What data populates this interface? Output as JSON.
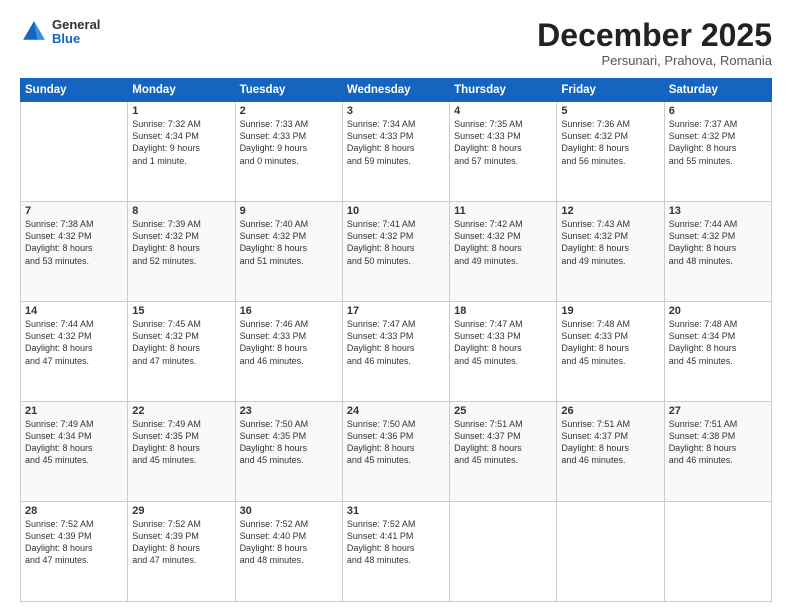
{
  "logo": {
    "general": "General",
    "blue": "Blue"
  },
  "header": {
    "month": "December 2025",
    "location": "Persunari, Prahova, Romania"
  },
  "weekdays": [
    "Sunday",
    "Monday",
    "Tuesday",
    "Wednesday",
    "Thursday",
    "Friday",
    "Saturday"
  ],
  "weeks": [
    [
      {
        "day": "",
        "info": ""
      },
      {
        "day": "1",
        "info": "Sunrise: 7:32 AM\nSunset: 4:34 PM\nDaylight: 9 hours\nand 1 minute."
      },
      {
        "day": "2",
        "info": "Sunrise: 7:33 AM\nSunset: 4:33 PM\nDaylight: 9 hours\nand 0 minutes."
      },
      {
        "day": "3",
        "info": "Sunrise: 7:34 AM\nSunset: 4:33 PM\nDaylight: 8 hours\nand 59 minutes."
      },
      {
        "day": "4",
        "info": "Sunrise: 7:35 AM\nSunset: 4:33 PM\nDaylight: 8 hours\nand 57 minutes."
      },
      {
        "day": "5",
        "info": "Sunrise: 7:36 AM\nSunset: 4:32 PM\nDaylight: 8 hours\nand 56 minutes."
      },
      {
        "day": "6",
        "info": "Sunrise: 7:37 AM\nSunset: 4:32 PM\nDaylight: 8 hours\nand 55 minutes."
      }
    ],
    [
      {
        "day": "7",
        "info": "Sunrise: 7:38 AM\nSunset: 4:32 PM\nDaylight: 8 hours\nand 53 minutes."
      },
      {
        "day": "8",
        "info": "Sunrise: 7:39 AM\nSunset: 4:32 PM\nDaylight: 8 hours\nand 52 minutes."
      },
      {
        "day": "9",
        "info": "Sunrise: 7:40 AM\nSunset: 4:32 PM\nDaylight: 8 hours\nand 51 minutes."
      },
      {
        "day": "10",
        "info": "Sunrise: 7:41 AM\nSunset: 4:32 PM\nDaylight: 8 hours\nand 50 minutes."
      },
      {
        "day": "11",
        "info": "Sunrise: 7:42 AM\nSunset: 4:32 PM\nDaylight: 8 hours\nand 49 minutes."
      },
      {
        "day": "12",
        "info": "Sunrise: 7:43 AM\nSunset: 4:32 PM\nDaylight: 8 hours\nand 49 minutes."
      },
      {
        "day": "13",
        "info": "Sunrise: 7:44 AM\nSunset: 4:32 PM\nDaylight: 8 hours\nand 48 minutes."
      }
    ],
    [
      {
        "day": "14",
        "info": "Sunrise: 7:44 AM\nSunset: 4:32 PM\nDaylight: 8 hours\nand 47 minutes."
      },
      {
        "day": "15",
        "info": "Sunrise: 7:45 AM\nSunset: 4:32 PM\nDaylight: 8 hours\nand 47 minutes."
      },
      {
        "day": "16",
        "info": "Sunrise: 7:46 AM\nSunset: 4:33 PM\nDaylight: 8 hours\nand 46 minutes."
      },
      {
        "day": "17",
        "info": "Sunrise: 7:47 AM\nSunset: 4:33 PM\nDaylight: 8 hours\nand 46 minutes."
      },
      {
        "day": "18",
        "info": "Sunrise: 7:47 AM\nSunset: 4:33 PM\nDaylight: 8 hours\nand 45 minutes."
      },
      {
        "day": "19",
        "info": "Sunrise: 7:48 AM\nSunset: 4:33 PM\nDaylight: 8 hours\nand 45 minutes."
      },
      {
        "day": "20",
        "info": "Sunrise: 7:48 AM\nSunset: 4:34 PM\nDaylight: 8 hours\nand 45 minutes."
      }
    ],
    [
      {
        "day": "21",
        "info": "Sunrise: 7:49 AM\nSunset: 4:34 PM\nDaylight: 8 hours\nand 45 minutes."
      },
      {
        "day": "22",
        "info": "Sunrise: 7:49 AM\nSunset: 4:35 PM\nDaylight: 8 hours\nand 45 minutes."
      },
      {
        "day": "23",
        "info": "Sunrise: 7:50 AM\nSunset: 4:35 PM\nDaylight: 8 hours\nand 45 minutes."
      },
      {
        "day": "24",
        "info": "Sunrise: 7:50 AM\nSunset: 4:36 PM\nDaylight: 8 hours\nand 45 minutes."
      },
      {
        "day": "25",
        "info": "Sunrise: 7:51 AM\nSunset: 4:37 PM\nDaylight: 8 hours\nand 45 minutes."
      },
      {
        "day": "26",
        "info": "Sunrise: 7:51 AM\nSunset: 4:37 PM\nDaylight: 8 hours\nand 46 minutes."
      },
      {
        "day": "27",
        "info": "Sunrise: 7:51 AM\nSunset: 4:38 PM\nDaylight: 8 hours\nand 46 minutes."
      }
    ],
    [
      {
        "day": "28",
        "info": "Sunrise: 7:52 AM\nSunset: 4:39 PM\nDaylight: 8 hours\nand 47 minutes."
      },
      {
        "day": "29",
        "info": "Sunrise: 7:52 AM\nSunset: 4:39 PM\nDaylight: 8 hours\nand 47 minutes."
      },
      {
        "day": "30",
        "info": "Sunrise: 7:52 AM\nSunset: 4:40 PM\nDaylight: 8 hours\nand 48 minutes."
      },
      {
        "day": "31",
        "info": "Sunrise: 7:52 AM\nSunset: 4:41 PM\nDaylight: 8 hours\nand 48 minutes."
      },
      {
        "day": "",
        "info": ""
      },
      {
        "day": "",
        "info": ""
      },
      {
        "day": "",
        "info": ""
      }
    ]
  ]
}
